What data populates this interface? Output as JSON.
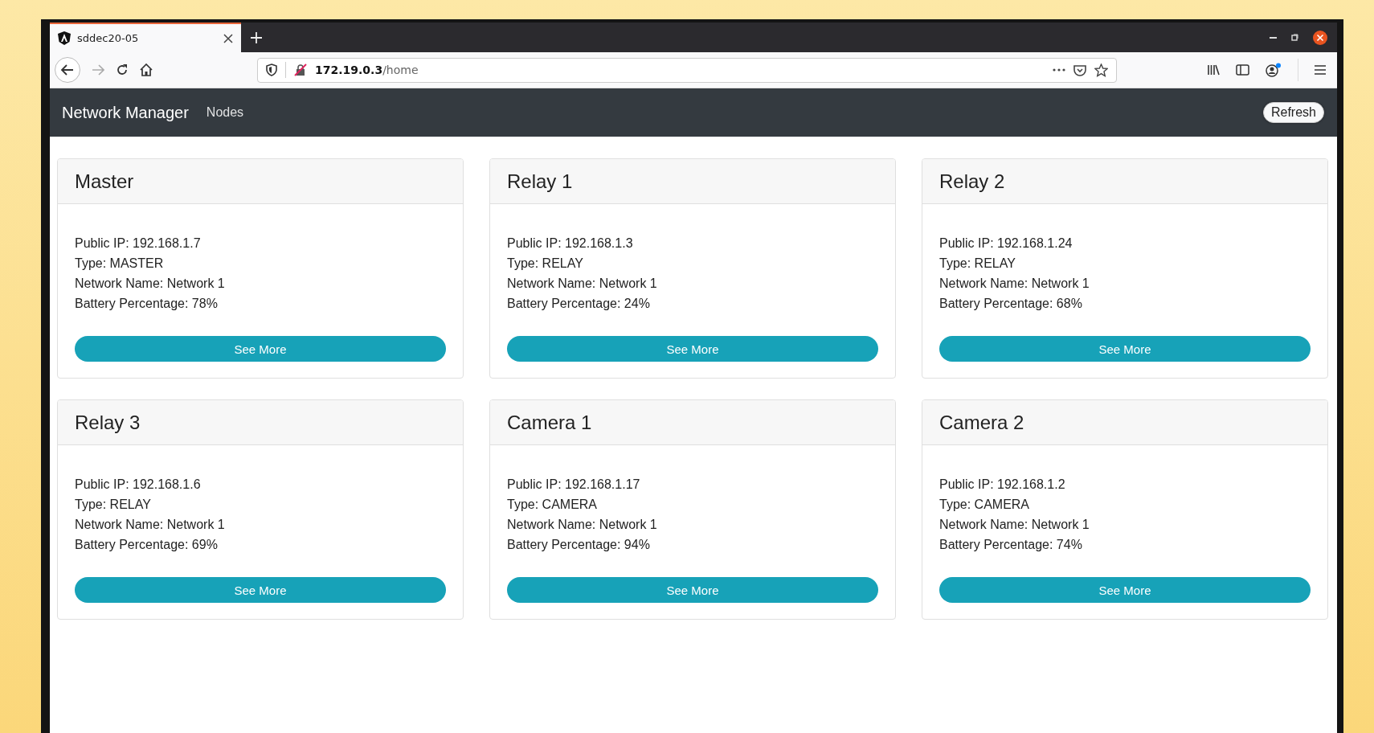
{
  "browser": {
    "tab_title": "sddec20-05",
    "url_host": "172.19.0.3",
    "url_path": "/home"
  },
  "navbar": {
    "brand": "Network Manager",
    "links": [
      "Nodes"
    ],
    "refresh_button": "Refresh"
  },
  "nodes": [
    {
      "title": "Master",
      "lines": [
        "Public IP: 192.168.1.7",
        "Type: MASTER",
        "Network Name: Network 1",
        "Battery Percentage: 78%"
      ],
      "button": "See More"
    },
    {
      "title": "Relay 1",
      "lines": [
        "Public IP: 192.168.1.3",
        "Type: RELAY",
        "Network Name: Network 1",
        "Battery Percentage: 24%"
      ],
      "button": "See More"
    },
    {
      "title": "Relay 2",
      "lines": [
        "Public IP: 192.168.1.24",
        "Type: RELAY",
        "Network Name: Network 1",
        "Battery Percentage: 68%"
      ],
      "button": "See More"
    },
    {
      "title": "Relay 3",
      "lines": [
        "Public IP: 192.168.1.6",
        "Type: RELAY",
        "Network Name: Network 1",
        "Battery Percentage: 69%"
      ],
      "button": "See More"
    },
    {
      "title": "Camera 1",
      "lines": [
        "Public IP: 192.168.1.17",
        "Type: CAMERA",
        "Network Name: Network 1",
        "Battery Percentage: 94%"
      ],
      "button": "See More"
    },
    {
      "title": "Camera 2",
      "lines": [
        "Public IP: 192.168.1.2",
        "Type: CAMERA",
        "Network Name: Network 1",
        "Battery Percentage: 74%"
      ],
      "button": "See More"
    }
  ]
}
